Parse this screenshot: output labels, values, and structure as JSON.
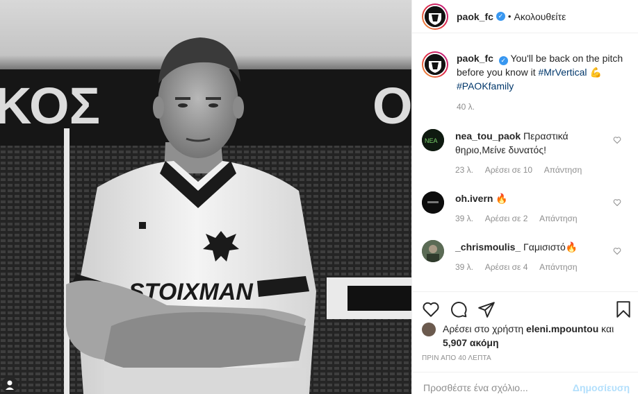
{
  "post": {
    "username": "paok_fc",
    "verified_icon": "verified-badge-icon",
    "separator": "•",
    "follow_status": "Ακολουθείτε"
  },
  "caption": {
    "username": "paok_fc",
    "text": "You'll be back on the pitch before you know it",
    "hashtag1": "#MrVertical",
    "emoji": "💪",
    "hashtag2": "#PAOKfamily",
    "time": "40 λ."
  },
  "comments": [
    {
      "user": "nea_tou_paok",
      "text": "Περαστικά θηριο,Μείνε δυνατός!",
      "time": "23 λ.",
      "likes": "Αρέσει σε 10",
      "reply": "Απάντηση"
    },
    {
      "user": "oh.ivern",
      "text": "🔥",
      "time": "39 λ.",
      "likes": "Αρέσει σε 2",
      "reply": "Απάντηση"
    },
    {
      "user": "_chrismoulis_",
      "text": "Γαμισιστό🔥",
      "time": "39 λ.",
      "likes": "Αρέσει σε 4",
      "reply": "Απάντηση"
    }
  ],
  "likes": {
    "prefix": "Αρέσει στο χρήστη",
    "user": "eleni.mpountou",
    "connector": "και",
    "count": "5,907 ακόμη"
  },
  "posted": "ΠΡΙΝ ΑΠΟ 40 ΛΕΠΤΑ",
  "add_comment": {
    "placeholder": "Προσθέστε ένα σχόλιο...",
    "post_label": "Δημοσίευση"
  },
  "photo": {
    "stadium_text_left": "ΚΟΣ",
    "stadium_text_right": "Ο",
    "sponsor": "STOIXMAN"
  },
  "colors": {
    "link": "#00376b",
    "post_disabled": "#b2dffc",
    "verified": "#3897f0",
    "muted": "#8e8e8e"
  }
}
